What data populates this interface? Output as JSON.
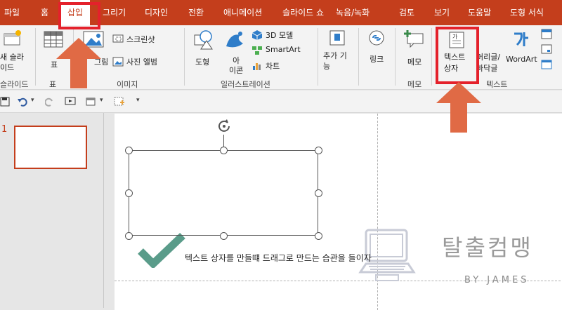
{
  "tabs": [
    "파일",
    "홈",
    "삽입",
    "그리기",
    "디자인",
    "전환",
    "애니메이션",
    "슬라이드 쇼",
    "녹음/녹화",
    "검토",
    "보기",
    "도움말",
    "도형 서식"
  ],
  "ribbon": {
    "new_slide": "새 슬라\n이드",
    "slides_group": "슬라이드",
    "table": "표",
    "table_group": "표",
    "pictures": "그림",
    "screenshot": "스크린샷",
    "photo_album": "사진 앨범",
    "images_group": "이미지",
    "shapes": "도형",
    "icons": "아\n이콘",
    "models_3d": "3D 모델",
    "smartart": "SmartArt",
    "chart": "차트",
    "illustrations_group": "일러스트레이션",
    "addins": "추가 기\n능",
    "link": "링크",
    "comment": "메모",
    "comment_group": "메모",
    "textbox": "텍스트\n상자",
    "header_footer": "머리글/\n바닥글",
    "wordart": "WordArt",
    "text_group": "텍스트"
  },
  "thumbnail_number": "1",
  "tip_text": "텍스트 상자를 만들떄 드래그로 만드는 습관을 들이자",
  "watermark": {
    "title": "탈출컴맹",
    "byline": "BY JAMES"
  },
  "colors": {
    "accent": "#c43e1c",
    "highlight": "#e4212b",
    "arrow": "#e06a45",
    "check": "#5a9c8a"
  }
}
